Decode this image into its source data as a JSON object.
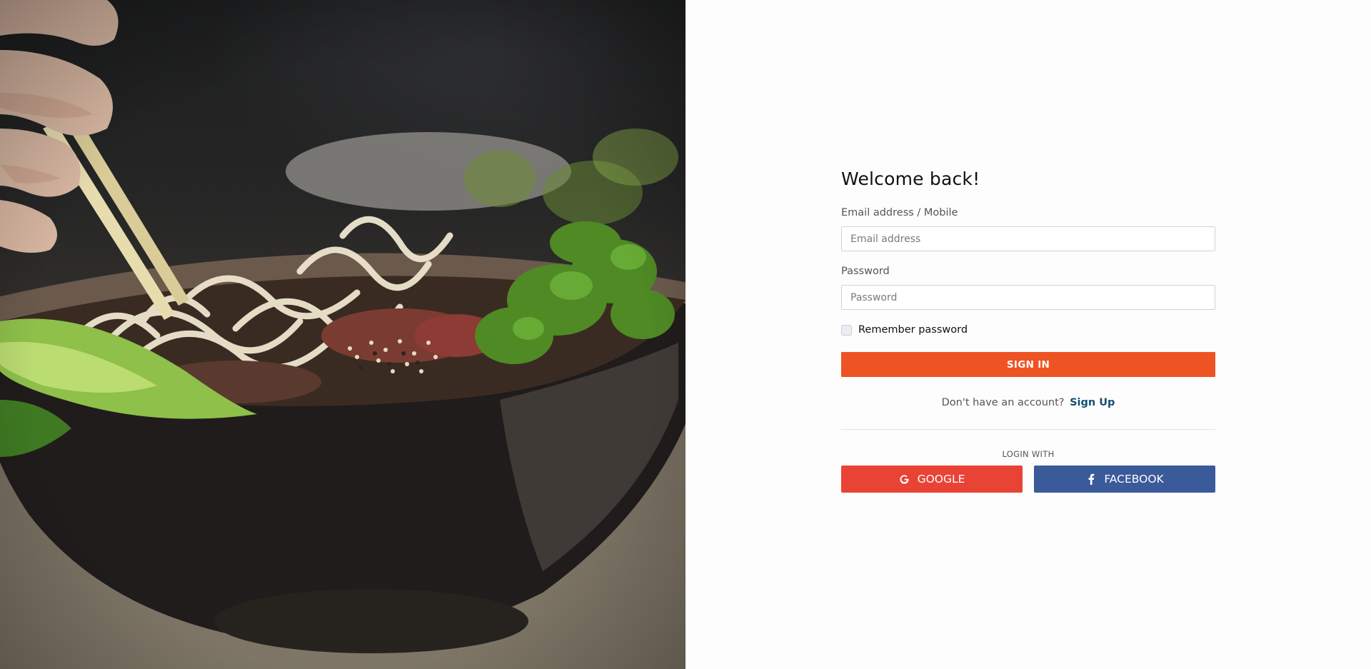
{
  "form": {
    "title": "Welcome back!",
    "email": {
      "label": "Email address / Mobile",
      "placeholder": "Email address",
      "value": ""
    },
    "password": {
      "label": "Password",
      "placeholder": "Password",
      "value": ""
    },
    "remember_label": "Remember password",
    "remember_checked": false,
    "signin_label": "SIGN IN",
    "signup_prompt": "Don't have an account?",
    "signup_link": "Sign Up",
    "login_with": "LOGIN WITH",
    "google_label": "GOOGLE",
    "facebook_label": "FACEBOOK"
  },
  "icons": {
    "google": "google-icon",
    "facebook": "facebook-icon"
  },
  "colors": {
    "accent": "#ee5324",
    "google": "#e94335",
    "facebook": "#3b5a9a",
    "link": "#164e73"
  },
  "hero_image": "noodle-bowl-photo"
}
